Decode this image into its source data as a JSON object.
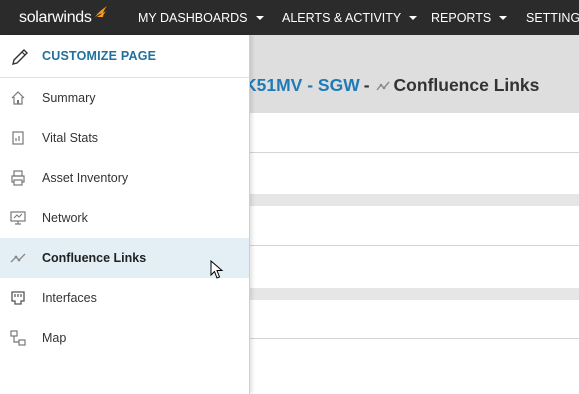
{
  "topnav": {
    "logo_text": "solarwinds",
    "items": [
      {
        "label": "MY DASHBOARDS"
      },
      {
        "label": "ALERTS & ACTIVITY"
      },
      {
        "label": "REPORTS"
      },
      {
        "label": "SETTINGS"
      }
    ]
  },
  "page": {
    "title_link": "K51MV - SGW",
    "title_separator": "-",
    "title_text": "Confluence Links"
  },
  "sidemenu": {
    "customize_label": "CUSTOMIZE PAGE",
    "items": [
      {
        "label": "Summary",
        "icon": "home-icon"
      },
      {
        "label": "Vital Stats",
        "icon": "chart-icon"
      },
      {
        "label": "Asset Inventory",
        "icon": "printer-icon"
      },
      {
        "label": "Network",
        "icon": "monitor-icon"
      },
      {
        "label": "Confluence Links",
        "icon": "links-icon",
        "active": true
      },
      {
        "label": "Interfaces",
        "icon": "ethernet-port-icon"
      },
      {
        "label": "Map",
        "icon": "network-map-icon"
      }
    ]
  },
  "colors": {
    "topbar": "#2b2b2b",
    "brand_orange": "#f99d1c",
    "link_blue": "#1f7ab8",
    "customize_blue": "#1f6f9f",
    "active_bg": "#e3eff5"
  }
}
